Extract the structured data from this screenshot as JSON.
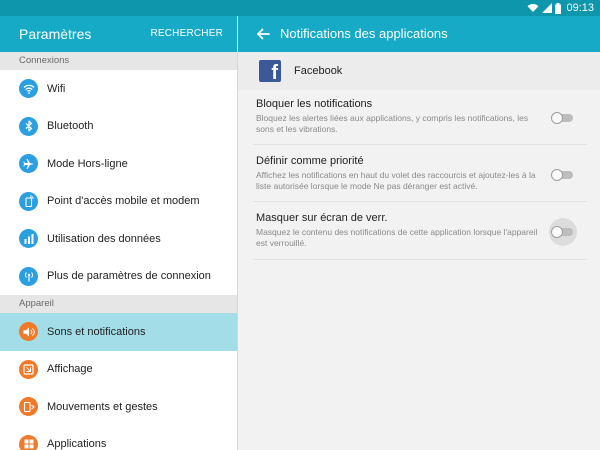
{
  "status": {
    "time": "09:13"
  },
  "left_header": {
    "title": "Paramètres",
    "search_label": "RECHERCHER"
  },
  "right_header": {
    "title": "Notifications des applications"
  },
  "sections": {
    "connexions": "Connexions",
    "appareil": "Appareil"
  },
  "items": [
    {
      "label": "Wifi",
      "icon": "wifi-icon"
    },
    {
      "label": "Bluetooth",
      "icon": "bluetooth-icon"
    },
    {
      "label": "Mode Hors-ligne",
      "icon": "airplane-icon"
    },
    {
      "label": "Point d'accès mobile et modem",
      "icon": "hotspot-icon"
    },
    {
      "label": "Utilisation des données",
      "icon": "data-usage-icon"
    },
    {
      "label": "Plus de paramètres de connexion",
      "icon": "more-connection-icon"
    },
    {
      "label": "Sons et notifications",
      "icon": "sound-icon",
      "selected": true
    },
    {
      "label": "Affichage",
      "icon": "display-icon"
    },
    {
      "label": "Mouvements et gestes",
      "icon": "motion-icon"
    },
    {
      "label": "Applications",
      "icon": "apps-icon"
    }
  ],
  "app": {
    "name": "Facebook",
    "icon": "facebook-icon"
  },
  "settings": [
    {
      "title": "Bloquer les notifications",
      "description": "Bloquez les alertes liées aux applications, y compris les notifications, les sons et les vibrations.",
      "enabled": false
    },
    {
      "title": "Définir comme priorité",
      "description": "Affichez les notifications en haut du volet des raccourcis et ajoutez-les à la liste autorisée lorsque le mode Ne pas déranger est activé.",
      "enabled": false
    },
    {
      "title": "Masquer sur écran de verr.",
      "description": "Masquez le contenu des notifications de cette application lorsque l'appareil est verrouillé.",
      "enabled": false
    }
  ],
  "colors": {
    "header": "#16aac6",
    "statusbar": "#0e96ad",
    "selected_row": "#a3dee8",
    "icon_blue": "#2c9fe0",
    "icon_orange": "#ef7a29",
    "facebook": "#3b5998"
  }
}
